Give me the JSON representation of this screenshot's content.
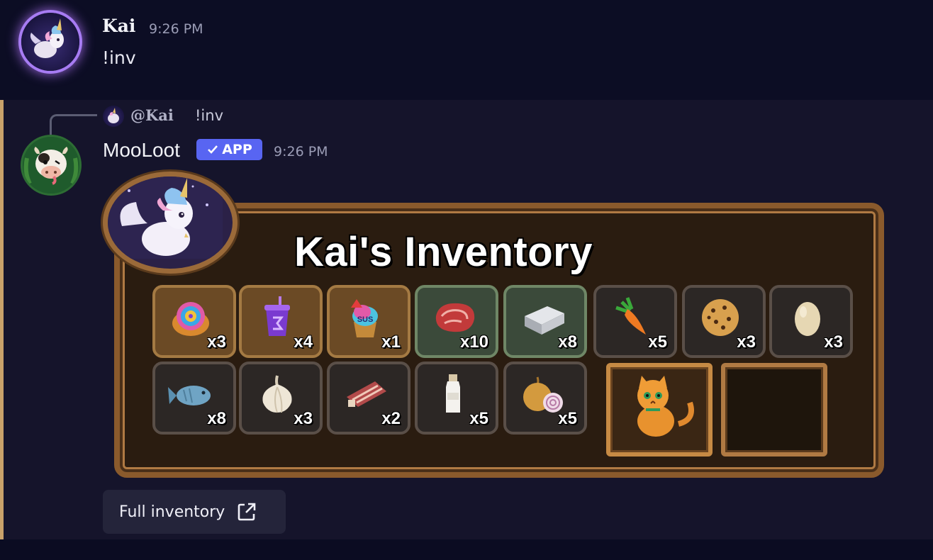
{
  "message_user": {
    "author": "Kai",
    "time": "9:26 PM",
    "text": "!inv"
  },
  "message_bot": {
    "reply": {
      "author": "@Kai",
      "text": "!inv"
    },
    "author": "MooLoot",
    "badge": "APP",
    "time": "9:26 PM",
    "card": {
      "title": "Kai's Inventory",
      "items_row1": [
        {
          "name": "rainbow-bun",
          "qty": "x3"
        },
        {
          "name": "purple-drink",
          "qty": "x4"
        },
        {
          "name": "sus-cupcake",
          "qty": "x1"
        },
        {
          "name": "raw-steak",
          "qty": "x10"
        },
        {
          "name": "iron-ingot",
          "qty": "x8"
        },
        {
          "name": "carrot",
          "qty": "x5"
        },
        {
          "name": "cookie",
          "qty": "x3"
        },
        {
          "name": "egg",
          "qty": "x3"
        }
      ],
      "items_row2": [
        {
          "name": "fish",
          "qty": "x8"
        },
        {
          "name": "garlic",
          "qty": "x3"
        },
        {
          "name": "raw-ribs",
          "qty": "x2"
        },
        {
          "name": "milk-bottle",
          "qty": "x5"
        },
        {
          "name": "onion",
          "qty": "x5"
        }
      ]
    },
    "button": {
      "label": "Full inventory",
      "icon": "external-link-icon"
    }
  },
  "colors": {
    "background": "#0c0d24",
    "bot_message_bg": "#15142b",
    "highlight_bar": "#c9a26a",
    "app_badge": "#5865f2",
    "frame_wood": "#8a5a2c"
  }
}
